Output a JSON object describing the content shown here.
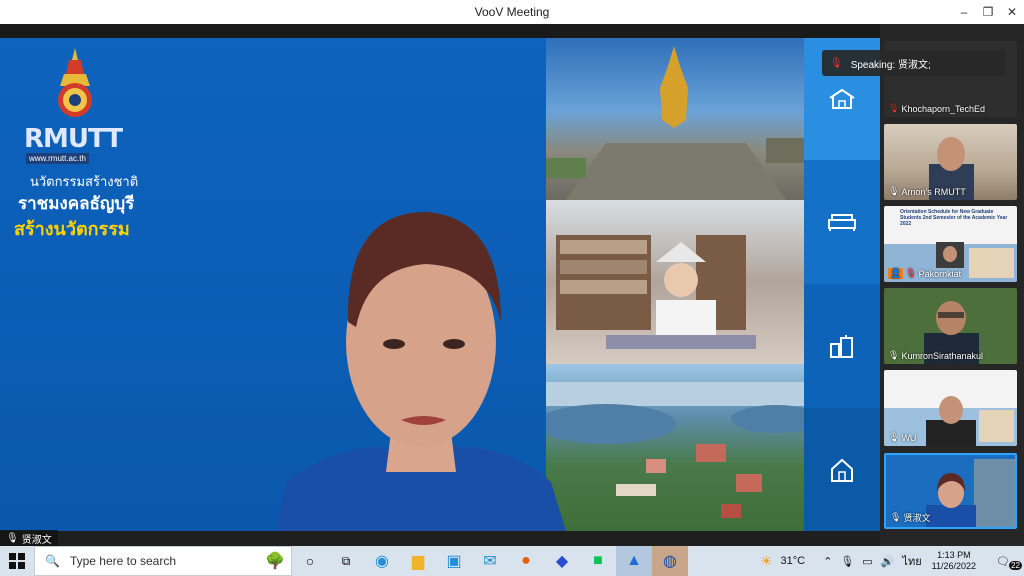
{
  "window": {
    "title": "VooV Meeting",
    "minimize": "–",
    "restore": "❐",
    "close": "✕"
  },
  "share": {
    "logo_text": "RMUTT",
    "logo_url": "www.rmutt.ac.th",
    "slogan_line1": "นวัตกรรมสร้างชาติ",
    "slogan_line2": "ราชมงคลธัญบุรี",
    "slogan_line3": "สร้างนวัตกรรม"
  },
  "video_name": "贤淑文",
  "speaking_banner": "Speaking: 贤淑文;",
  "participants": [
    {
      "name": "Khochaporn_TechEd",
      "mic": "muted"
    },
    {
      "name": "Arnon’s RMUTT",
      "mic": "on"
    },
    {
      "name": "Pakornkiat",
      "mic": "muted"
    },
    {
      "name": "KumronSirathanakul",
      "mic": "on"
    },
    {
      "name": "WU",
      "mic": "on"
    },
    {
      "name": "贤淑文",
      "mic": "on"
    }
  ],
  "slide_thumb_title": "Orientation Schedule for New Graduate Students 2nd Semester of the Academic Year 2022",
  "taskbar": {
    "search_placeholder": "Type here to search",
    "weather": "31°C",
    "language": "ไทย",
    "time": "1:13 PM",
    "date": "11/26/2022",
    "notifications": "22"
  },
  "colors": {
    "accent": "#0a5fb4",
    "highlight": "#2fa4ff",
    "gold": "#ffd200"
  }
}
